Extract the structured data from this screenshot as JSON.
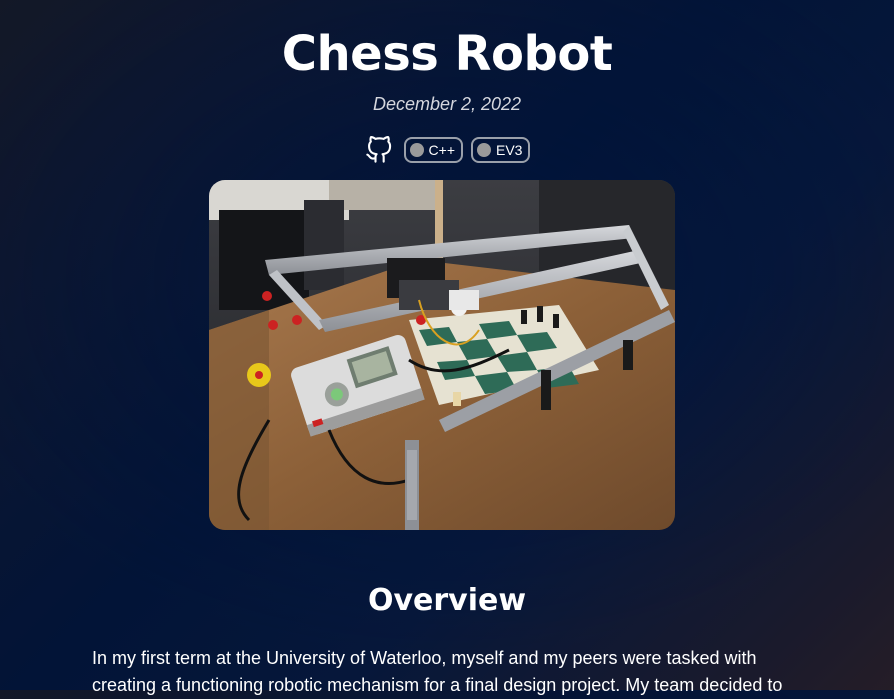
{
  "project": {
    "title": "Chess Robot",
    "date": "December 2, 2022",
    "github_icon": "github-icon",
    "tags": [
      {
        "label": "C++",
        "dot_color": "#9a9a9a"
      },
      {
        "label": "EV3",
        "dot_color": "#9a9a9a"
      }
    ],
    "image_description_icon": "robot-photo"
  },
  "overview": {
    "heading": "Overview",
    "text": "In my first term at the University of Waterloo, myself and my peers were tasked with creating a functioning robotic mechanism for a final design project. My team decided to"
  },
  "colors": {
    "background_top": "#0c1630",
    "background_center": "#021437",
    "text": "#ffffff",
    "date_text": "#d5d7de",
    "tag_border": "#9aa0aa"
  }
}
